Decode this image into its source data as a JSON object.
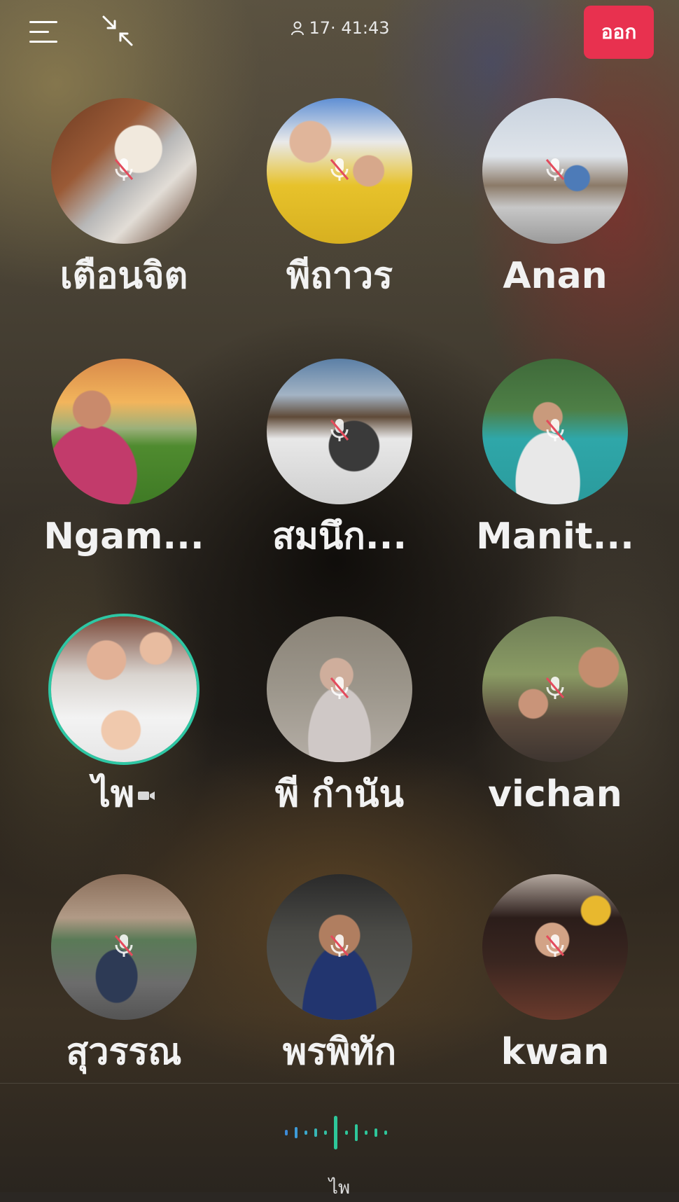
{
  "header": {
    "listener_count": "17",
    "timer": "41:43",
    "leave_label": "ออก"
  },
  "participants": [
    {
      "name": "เตือนจิต",
      "muted": true,
      "speaking": false
    },
    {
      "name": "พีถาวร",
      "muted": true,
      "speaking": false
    },
    {
      "name": "Anan",
      "muted": true,
      "speaking": false
    },
    {
      "name": "Ngam...",
      "muted": false,
      "speaking": false
    },
    {
      "name": "สมนึก...",
      "muted": true,
      "speaking": false
    },
    {
      "name": "Manit...",
      "muted": true,
      "speaking": false
    },
    {
      "name": "ไพ",
      "muted": false,
      "speaking": true,
      "camera": true
    },
    {
      "name": "พี กำนัน",
      "muted": true,
      "speaking": false
    },
    {
      "name": "vichan",
      "muted": true,
      "speaking": false
    },
    {
      "name": "สุวรรณ",
      "muted": true,
      "speaking": false
    },
    {
      "name": "พรพิทัก",
      "muted": true,
      "speaking": false
    },
    {
      "name": "kwan",
      "muted": true,
      "speaking": false
    }
  ],
  "footer": {
    "current_speaker": "ไพ"
  },
  "colors": {
    "leave_button": "#e8314f",
    "speaking_ring": "#2ec7a4"
  },
  "icons": {
    "menu": "menu-icon",
    "minimize": "minimize-icon",
    "person": "person-icon",
    "mute": "mic-off-icon",
    "camera": "video-camera-icon",
    "wave": "audio-wave-icon"
  }
}
